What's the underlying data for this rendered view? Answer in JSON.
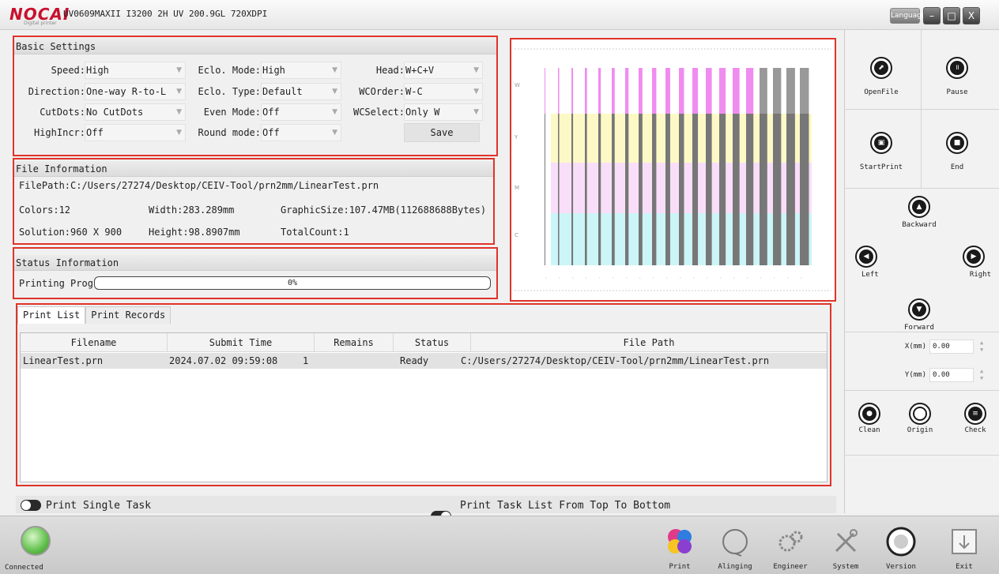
{
  "window": {
    "logo": "NOCAI",
    "logo_sub": "Digital printer",
    "title": "UV0609MAXII I3200 2H UV 200.9GL 720XDPI",
    "language_label": "Language",
    "minimize": "–",
    "maximize": "□",
    "close": "X"
  },
  "basic_settings": {
    "title": "Basic Settings",
    "col1": [
      {
        "label": "Speed:",
        "value": "High"
      },
      {
        "label": "Direction:",
        "value": "One-way R-to-L"
      },
      {
        "label": "CutDots:",
        "value": "No CutDots"
      },
      {
        "label": "HighIncr:",
        "value": "Off"
      }
    ],
    "col2": [
      {
        "label": "Eclo. Mode:",
        "value": "High"
      },
      {
        "label": "Eclo. Type:",
        "value": "Default"
      },
      {
        "label": "Even Mode:",
        "value": "Off"
      },
      {
        "label": "Round mode:",
        "value": "Off"
      }
    ],
    "col3": [
      {
        "label": "Head:",
        "value": "W+C+V"
      },
      {
        "label": "WCOrder:",
        "value": "W-C"
      },
      {
        "label": "WCSelect:",
        "value": "Only W"
      }
    ],
    "save_label": "Save"
  },
  "file_info": {
    "title": "File Information",
    "filepath": "FilePath:C:/Users/27274/Desktop/CEIV-Tool/prn2mm/LinearTest.prn",
    "colors": "Colors:12",
    "width": "Width:283.289mm",
    "graphic_size": "GraphicSize:107.47MB(112688688Bytes)",
    "solution": "Solution:960 X 900",
    "height": "Height:98.8907mm",
    "total_count": "TotalCount:1"
  },
  "status_info": {
    "title": "Status Information",
    "progress_label": "Printing Prog",
    "progress_text": "0%",
    "progress_value": 0
  },
  "print_list": {
    "tabs": [
      "Print List",
      "Print Records"
    ],
    "columns": [
      "Filename",
      "Submit Time",
      "Remains",
      "Status",
      "File Path"
    ],
    "rows": [
      [
        "LinearTest.prn",
        "2024.07.02 09:59:08",
        "1",
        "Ready",
        "C:/Users/27274/Desktop/CEIV-Tool/prn2mm/LinearTest.prn"
      ]
    ]
  },
  "toggles": {
    "single_task": "Print Single Task",
    "task_list": "Print Task List From Top To Bottom"
  },
  "right_panel": {
    "open_file": "OpenFile",
    "pause": "Pause",
    "start_print": "StartPrint",
    "end": "End",
    "backward": "Backward",
    "left": "Left",
    "right": "Right",
    "forward": "Forward",
    "x_label": "X(mm)",
    "x_value": "0.00",
    "y_label": "Y(mm)",
    "y_value": "0.00",
    "clean": "Clean",
    "origin": "Origin",
    "check": "Check"
  },
  "bottom_bar": {
    "connected": "Connected",
    "print": "Print",
    "aligning": "Alinging",
    "engineer": "Engineer",
    "system": "System",
    "version": "Version",
    "exit": "Exit"
  },
  "colors": {
    "accent_red": "#e0342a",
    "magenta": "#f08cf0",
    "yellow": "#fbf5a0",
    "pink": "#f5c8f5",
    "cyan": "#a8eef2"
  }
}
